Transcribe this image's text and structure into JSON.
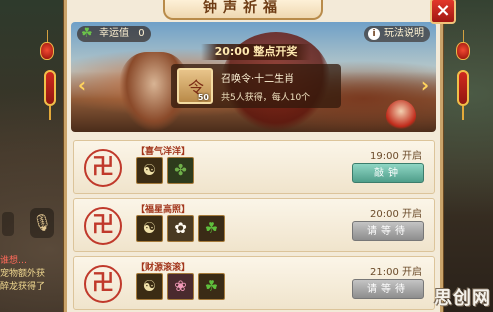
{
  "title": "钟声祈福",
  "close_label": "×",
  "luck": {
    "label": "幸运值",
    "value": "0"
  },
  "rules_label": "玩法说明",
  "prize": {
    "time_label": "20:00 整点开奖",
    "name": "召唤令·十二生肖",
    "count": "50",
    "desc": "共5人获得，每人10个"
  },
  "rows": [
    {
      "title": "【喜气洋洋】",
      "time": "19:00  开启",
      "button": "敲钟",
      "items": [
        "taiji-icon",
        "leaf-icon"
      ]
    },
    {
      "title": "【福星高照】",
      "time": "20:00  开启",
      "button": "请等待",
      "items": [
        "taiji-icon",
        "lily-icon",
        "clover-icon"
      ]
    },
    {
      "title": "【财源滚滚】",
      "time": "21:00  开启",
      "button": "请等待",
      "items": [
        "taiji-icon",
        "plum-icon",
        "clover-icon"
      ]
    }
  ],
  "chat": {
    "line1": "谁想…",
    "line2": "宠物额外获",
    "line3": "醉龙获得了"
  },
  "watermark": "思创网",
  "colors": {
    "panel_bg": "#f3ead8",
    "accent_red": "#c0392b",
    "active_button": "#4f9e8a",
    "wait_button": "#8d8d8d"
  }
}
